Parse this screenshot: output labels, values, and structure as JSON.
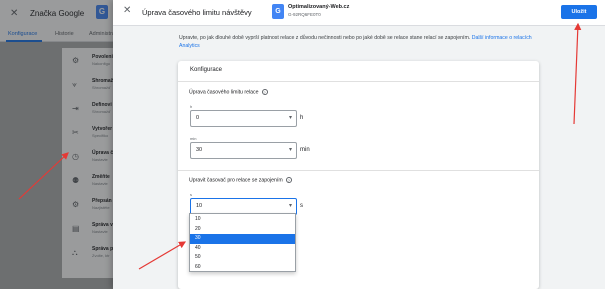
{
  "background": {
    "app_title": "Značka Google",
    "tabs": [
      "Konfigurace",
      "Historie",
      "Administrátor"
    ],
    "items": [
      {
        "title": "Povoleni",
        "sub": "Nakonfigu",
        "icon": "⚙"
      },
      {
        "title": "Shromaž",
        "sub": "Shromažď",
        "icon": "⟇"
      },
      {
        "title": "Definovi",
        "sub": "Shromažď",
        "icon": "⇥"
      },
      {
        "title": "Vytvořer",
        "sub": "Specifiko",
        "icon": "✂"
      },
      {
        "title": "Úprava č",
        "sub": "Nastavte",
        "icon": "◷"
      },
      {
        "title": "Změňte",
        "sub": "Nastavte",
        "icon": "⚉"
      },
      {
        "title": "Přepsán",
        "sub": "Nazjistěte",
        "icon": "⚙"
      },
      {
        "title": "Správa v",
        "sub": "Nastavte",
        "icon": "▤"
      },
      {
        "title": "Správa p",
        "sub": "Zvolte, ktr",
        "icon": "⛬"
      }
    ]
  },
  "panel": {
    "title": "Úprava časového limitu návštěvy",
    "account_name": "Optimalizovaný-Web.cz",
    "account_id": "G-92RQ6FE0T0",
    "save_label": "Uložit",
    "description": "Upravte, po jak dlouhé době vyprší platnost relace z důvodu nečinnosti nebo po jaké době se relace stane relací se zapojením.",
    "description_link": "Další informace o relacích Analytics"
  },
  "card": {
    "title": "Konfigurace",
    "timeout_section": "Úprava časového limitu relace",
    "hours_label": "h",
    "hours_value": "0",
    "hours_unit": "h",
    "minutes_label": "min",
    "minutes_value": "30",
    "minutes_unit": "min",
    "engaged_section": "Upravit časovač pro relace se zapojením",
    "seconds_label": "s",
    "seconds_value": "10",
    "seconds_unit": "s",
    "dropdown_options": [
      "10",
      "20",
      "30",
      "40",
      "50",
      "60"
    ],
    "dropdown_selected_index": 2
  },
  "colors": {
    "accent": "#1a73e8",
    "annotation_arrow": "#e53935"
  }
}
